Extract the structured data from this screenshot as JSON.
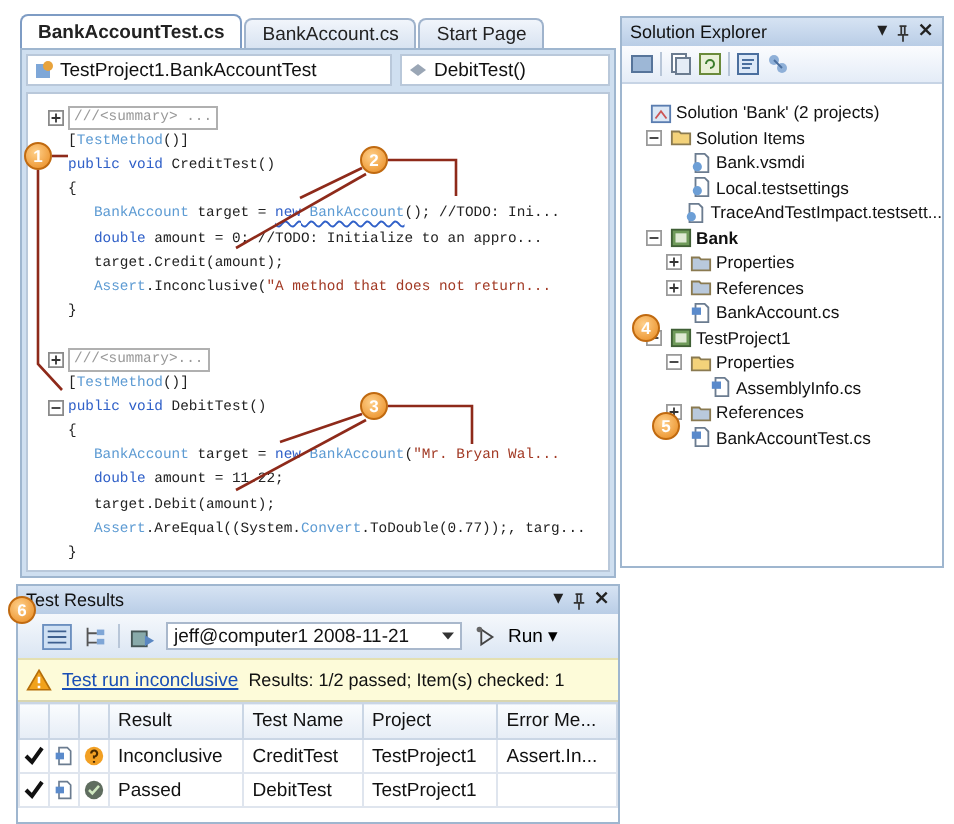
{
  "editor": {
    "tabs": [
      {
        "label": "BankAccountTest.cs",
        "selected": true
      },
      {
        "label": "BankAccount.cs",
        "selected": false
      },
      {
        "label": "Start Page",
        "selected": false
      }
    ],
    "type_dropdown": "TestProject1.BankAccountTest",
    "member_dropdown": "DebitTest()",
    "blocks": [
      {
        "lines": [
          {
            "expanded": false,
            "tokens": [
              {
                "kind": "collapsed",
                "text": "///<summary> ..."
              }
            ]
          },
          {
            "tokens": [
              {
                "kind": "plain",
                "text": "["
              },
              {
                "kind": "type",
                "text": "TestMethod"
              },
              {
                "kind": "plain",
                "text": "()]"
              }
            ]
          },
          {
            "tokens": [
              {
                "kind": "keyword",
                "text": "public void"
              },
              {
                "kind": "plain",
                "text": " CreditTest()"
              }
            ]
          },
          {
            "tokens": [
              {
                "kind": "plain",
                "text": "{"
              }
            ]
          },
          {
            "tokens": [
              {
                "kind": "type",
                "text": "   BankAccount"
              },
              {
                "kind": "plain",
                "text": " target = "
              },
              {
                "kind": "keyword",
                "text": "new",
                "squiggle": true
              },
              {
                "kind": "type",
                "text": " BankAccount",
                "squiggle": true
              },
              {
                "kind": "plain",
                "text": "(); //TODO: Ini..."
              }
            ]
          },
          {
            "tokens": [
              {
                "kind": "keyword",
                "text": "   double"
              },
              {
                "kind": "plain",
                "text": " amount = 0; //TODO: Initialize to an appro..."
              }
            ]
          },
          {
            "tokens": [
              {
                "kind": "plain",
                "text": "   target.Credit(amount);"
              }
            ]
          },
          {
            "tokens": [
              {
                "kind": "type",
                "text": "   Assert"
              },
              {
                "kind": "plain",
                "text": ".Inconclusive("
              },
              {
                "kind": "string",
                "text": "\"A method that does not return..."
              }
            ]
          },
          {
            "tokens": [
              {
                "kind": "plain",
                "text": "}"
              }
            ]
          }
        ]
      },
      {
        "lines": [
          {
            "expanded": false,
            "tokens": [
              {
                "kind": "collapsed",
                "text": "///<summary>..."
              }
            ]
          },
          {
            "tokens": [
              {
                "kind": "plain",
                "text": "["
              },
              {
                "kind": "type",
                "text": "TestMethod"
              },
              {
                "kind": "plain",
                "text": "()]"
              }
            ]
          },
          {
            "expanded": true,
            "tokens": [
              {
                "kind": "keyword",
                "text": "public void"
              },
              {
                "kind": "plain",
                "text": " DebitTest()"
              }
            ]
          },
          {
            "tokens": [
              {
                "kind": "plain",
                "text": "{"
              }
            ]
          },
          {
            "tokens": [
              {
                "kind": "type",
                "text": "   BankAccount"
              },
              {
                "kind": "plain",
                "text": " target = "
              },
              {
                "kind": "keyword",
                "text": "new",
                "squiggle": false
              },
              {
                "kind": "type",
                "text": " BankAccount",
                "squiggle": false
              },
              {
                "kind": "plain",
                "text": "("
              },
              {
                "kind": "string",
                "text": "\"Mr. Bryan Wal..."
              }
            ]
          },
          {
            "tokens": [
              {
                "kind": "keyword",
                "text": "   double"
              },
              {
                "kind": "plain",
                "text": " amount = 11.22;"
              }
            ]
          },
          {
            "tokens": [
              {
                "kind": "plain",
                "text": "   target.Debit(amount);"
              }
            ]
          },
          {
            "tokens": [
              {
                "kind": "type",
                "text": "   Assert"
              },
              {
                "kind": "plain",
                "text": ".AreEqual((System."
              },
              {
                "kind": "type",
                "text": "Convert"
              },
              {
                "kind": "plain",
                "text": ".ToDouble(0.77));, targ..."
              }
            ]
          },
          {
            "tokens": [
              {
                "kind": "plain",
                "text": "}"
              }
            ]
          }
        ]
      }
    ]
  },
  "solution_explorer": {
    "title": "Solution Explorer",
    "controls": [
      {
        "kind": "glyph",
        "text": "▾"
      },
      {
        "kind": "pin"
      },
      {
        "kind": "glyph",
        "text": "×"
      }
    ],
    "tree": [
      {
        "label": "Solution 'Bank' (2 projects)",
        "kind": "solution",
        "bold": false,
        "children": [
          {
            "label": "Solution Items",
            "kind": "folder",
            "bold": false,
            "expanded": true,
            "children": [
              {
                "label": "Bank.vsmdi",
                "kind": "file",
                "bold": false
              },
              {
                "label": "Local.testsettings",
                "kind": "file",
                "bold": false
              },
              {
                "label": "TraceAndTestImpact.testsett...",
                "kind": "file",
                "bold": false
              }
            ]
          },
          {
            "label": "Bank",
            "kind": "project",
            "bold": true,
            "expanded": true,
            "children": [
              {
                "label": "Properties",
                "kind": "folder",
                "bold": false,
                "expanded": false
              },
              {
                "label": "References",
                "kind": "folder",
                "bold": false,
                "expanded": false
              },
              {
                "label": "BankAccount.cs",
                "kind": "cs",
                "bold": false
              }
            ]
          },
          {
            "label": "TestProject1",
            "kind": "project",
            "bold": false,
            "expanded": true,
            "children": [
              {
                "label": "Properties",
                "kind": "folder",
                "bold": false,
                "expanded": true,
                "children": [
                  {
                    "label": "AssemblyInfo.cs",
                    "kind": "cs",
                    "bold": false
                  }
                ]
              },
              {
                "label": "References",
                "kind": "folder",
                "bold": false,
                "expanded": false
              },
              {
                "label": "BankAccountTest.cs",
                "kind": "cs",
                "bold": false
              }
            ]
          }
        ]
      }
    ]
  },
  "test_results": {
    "title": "Test Results",
    "controls": [
      {
        "kind": "glyph",
        "text": "▾"
      },
      {
        "kind": "pin"
      },
      {
        "kind": "glyph",
        "text": "×"
      }
    ],
    "run_config": "jeff@computer1 2008-11-21",
    "run_label": "Run",
    "run_caret": "▾",
    "status_link": "Test run inconclusive",
    "status_text": "Results: 1/2 passed; Item(s) checked: 1",
    "columns": [
      "Result",
      "Test Name",
      "Project",
      "Error Me..."
    ],
    "rows": [
      {
        "checked": true,
        "kind": "inconclusive",
        "result": "Inconclusive",
        "test_name": "CreditTest",
        "project": "TestProject1",
        "error": "Assert.In..."
      },
      {
        "checked": true,
        "kind": "passed",
        "result": "Passed",
        "test_name": "DebitTest",
        "project": "TestProject1"
      }
    ]
  },
  "callouts": [
    "1",
    "2",
    "3",
    "4",
    "5",
    "6"
  ]
}
